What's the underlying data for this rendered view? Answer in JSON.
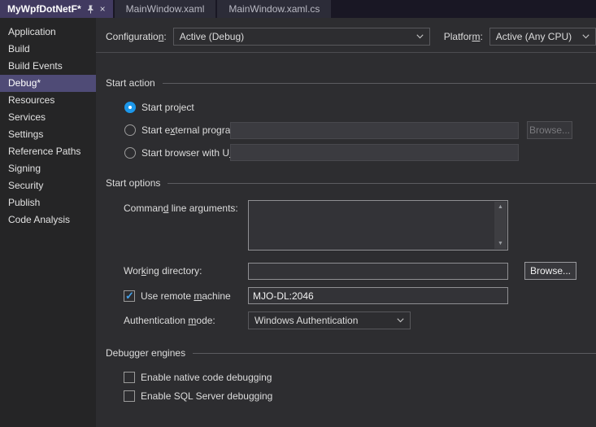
{
  "colors": {
    "background": "#2d2d30",
    "sidebar_background": "#252526",
    "tab_strip": "#191724",
    "active_tab_purple": "#413a60",
    "sidebar_selection_purple": "#4f4b76",
    "accent_blue": "#1c97ea",
    "check_blue": "#43a0e8",
    "text": "#dcdcdc"
  },
  "tab_bar": {
    "active_tab": "MyWpfDotNetF*",
    "tabs": [
      "MainWindow.xaml",
      "MainWindow.xaml.cs"
    ],
    "close_glyph": "×"
  },
  "sidebar": {
    "selected": "Debug*",
    "items": [
      "Application",
      "Build",
      "Build Events",
      "Debug*",
      "Resources",
      "Services",
      "Settings",
      "Reference Paths",
      "Signing",
      "Security",
      "Publish",
      "Code Analysis"
    ]
  },
  "config_bar": {
    "configuration_label": {
      "pre": "Configuratio",
      "key": "n",
      "post": ":"
    },
    "configuration_value": "Active (Debug)",
    "platform_label": {
      "pre": "Platfor",
      "key": "m",
      "post": ":"
    },
    "platform_value": "Active (Any CPU)"
  },
  "start_action": {
    "header": "Start action",
    "start_project": {
      "label": "Start project",
      "selected": true
    },
    "start_external": {
      "label": {
        "pre": "Start e",
        "key": "x",
        "post": "ternal program:"
      },
      "selected": false,
      "value": "",
      "browse_label": "Browse...",
      "browse_enabled": false
    },
    "start_browser": {
      "label": {
        "pre": "Start browser with U",
        "key": "R",
        "post": "L:"
      },
      "selected": false,
      "value": ""
    }
  },
  "start_options": {
    "header": "Start options",
    "command_line": {
      "label": {
        "pre": "Comman",
        "key": "d",
        "post": " line arguments:"
      },
      "value": ""
    },
    "working_directory": {
      "label": {
        "pre": "Wor",
        "key": "k",
        "post": "ing directory:"
      },
      "value": "",
      "browse_label": "Browse...",
      "browse_enabled": true
    },
    "remote_machine": {
      "label": {
        "pre": "Use remote ",
        "key": "m",
        "post": "achine"
      },
      "checked": true,
      "value": "MJO-DL:2046"
    },
    "auth_mode": {
      "label": {
        "pre": "Authentication ",
        "key": "m",
        "post": "ode:"
      },
      "value": "Windows Authentication"
    }
  },
  "debugger_engines": {
    "header": "Debugger engines",
    "native": {
      "label": "Enable native code debugging",
      "checked": false
    },
    "sql": {
      "label": "Enable SQL Server debugging",
      "checked": false
    }
  },
  "scrollbar": {
    "up_glyph": "▲",
    "down_glyph": "▼"
  }
}
